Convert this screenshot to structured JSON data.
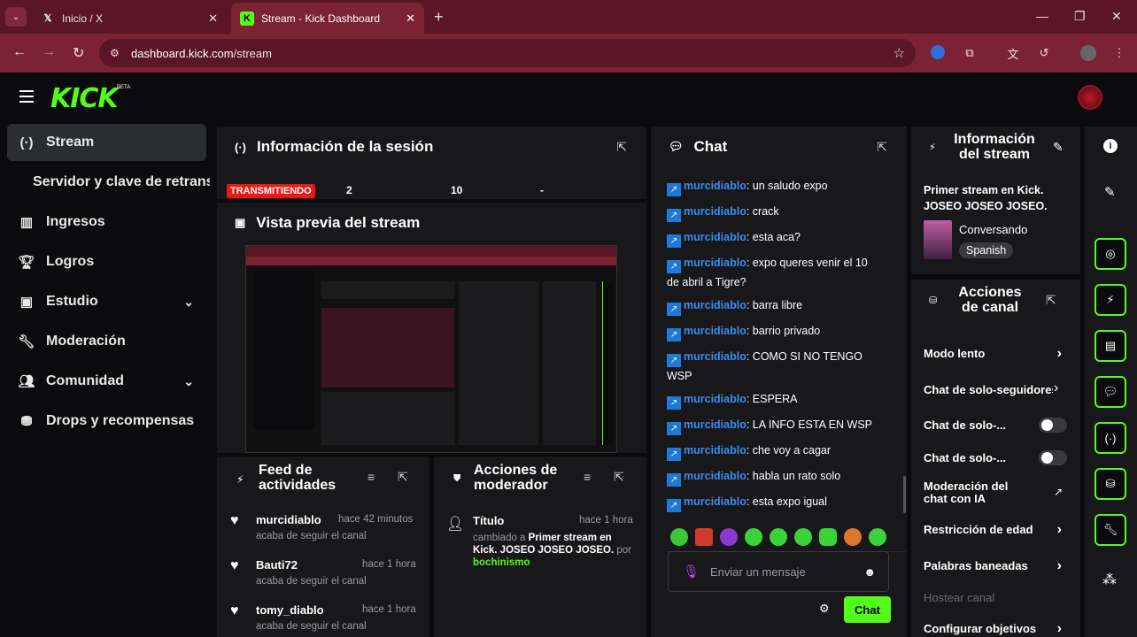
{
  "browser": {
    "tabs": [
      {
        "title": "Inicio / X",
        "icon": "x-logo-icon"
      },
      {
        "title": "Stream - Kick Dashboard",
        "icon": "kick-logo-icon"
      }
    ],
    "url_host": "dashboard.kick.com",
    "url_path": "/stream",
    "new_tab": "+"
  },
  "header": {
    "logo": "KICK",
    "beta": "BETA"
  },
  "sidebar": {
    "items": [
      {
        "label": "Stream",
        "icon": "broadcast-icon",
        "active": true
      },
      {
        "label": "Servidor y clave de retransmisión",
        "icon": ""
      },
      {
        "label": "Ingresos",
        "icon": "bar-chart-icon"
      },
      {
        "label": "Logros",
        "icon": "trophy-icon"
      },
      {
        "label": "Estudio",
        "icon": "studio-icon",
        "expandable": true
      },
      {
        "label": "Moderación",
        "icon": "wrench-icon"
      },
      {
        "label": "Comunidad",
        "icon": "users-icon",
        "expandable": true
      },
      {
        "label": "Drops y recompensas",
        "icon": "gift-icon"
      }
    ]
  },
  "session": {
    "title": "Información de la sesión",
    "status": "TRANSMITIENDO",
    "stat1": "2",
    "stat2": "10",
    "stat3": "-"
  },
  "preview": {
    "title": "Vista previa del stream"
  },
  "feed": {
    "title": "Feed de actividades",
    "items": [
      {
        "user": "murcidiablo",
        "time": "hace 42 minutos",
        "action": "acaba de seguir el canal"
      },
      {
        "user": "Bauti72",
        "time": "hace 1 hora",
        "action": "acaba de seguir el canal"
      },
      {
        "user": "tomy_diablo",
        "time": "hace 1 hora",
        "action": "acaba de seguir el canal"
      }
    ]
  },
  "modactions": {
    "title": "Acciones de moderador",
    "item": {
      "label": "Título",
      "time": "hace 1 hora",
      "prefix": "cambiado a ",
      "value": "Primer stream en Kick. JOSEO JOSEO JOSEO.",
      "by": " por ",
      "mod": "bochinismo"
    }
  },
  "chat": {
    "title": "Chat",
    "messages": [
      {
        "user": "murcidiablo",
        "text": ": un saludo expo"
      },
      {
        "user": "murcidiablo",
        "text": ": crack"
      },
      {
        "user": "murcidiablo",
        "text": ": esta aca?"
      },
      {
        "user": "murcidiablo",
        "text": ": expo queres venir el 10 de abril a Tigre?"
      },
      {
        "user": "murcidiablo",
        "text": ": barra libre"
      },
      {
        "user": "murcidiablo",
        "text": ": barrio privado"
      },
      {
        "user": "murcidiablo",
        "text": ": COMO SI NO TENGO WSP"
      },
      {
        "user": "murcidiablo",
        "text": ": ESPERA"
      },
      {
        "user": "murcidiablo",
        "text": ": LA INFO ESTA EN WSP"
      },
      {
        "user": "murcidiablo",
        "text": ": che voy a cagar"
      },
      {
        "user": "murcidiablo",
        "text": ": habla un rato solo"
      },
      {
        "user": "murcidiablo",
        "text": ": esta expo igual"
      }
    ],
    "placeholder": "Enviar un mensaje",
    "send_label": "Chat"
  },
  "streaminfo": {
    "title": "Información del stream",
    "stream_title": "Primer stream en Kick. JOSEO JOSEO JOSEO.",
    "category": "Conversando",
    "language": "Spanish"
  },
  "channelactions": {
    "title": "Acciones de canal",
    "items": [
      {
        "label": "Modo lento",
        "control": "chevron"
      },
      {
        "label": "Chat de solo-seguidores",
        "control": "chevron"
      },
      {
        "label": "Chat de solo-...",
        "control": "toggle"
      },
      {
        "label": "Chat de solo-...",
        "control": "toggle"
      },
      {
        "label": "Moderación del chat con IA",
        "control": "external"
      },
      {
        "label": "Restricción de edad",
        "control": "chevron"
      },
      {
        "label": "Palabras baneadas",
        "control": "chevron"
      },
      {
        "label": "Hostear canal",
        "control": "none"
      },
      {
        "label": "Configurar objetivos",
        "control": "chevron"
      }
    ]
  },
  "colors": {
    "accent": "#53fc18",
    "live": "#e91916",
    "username": "#3b8cf0"
  }
}
